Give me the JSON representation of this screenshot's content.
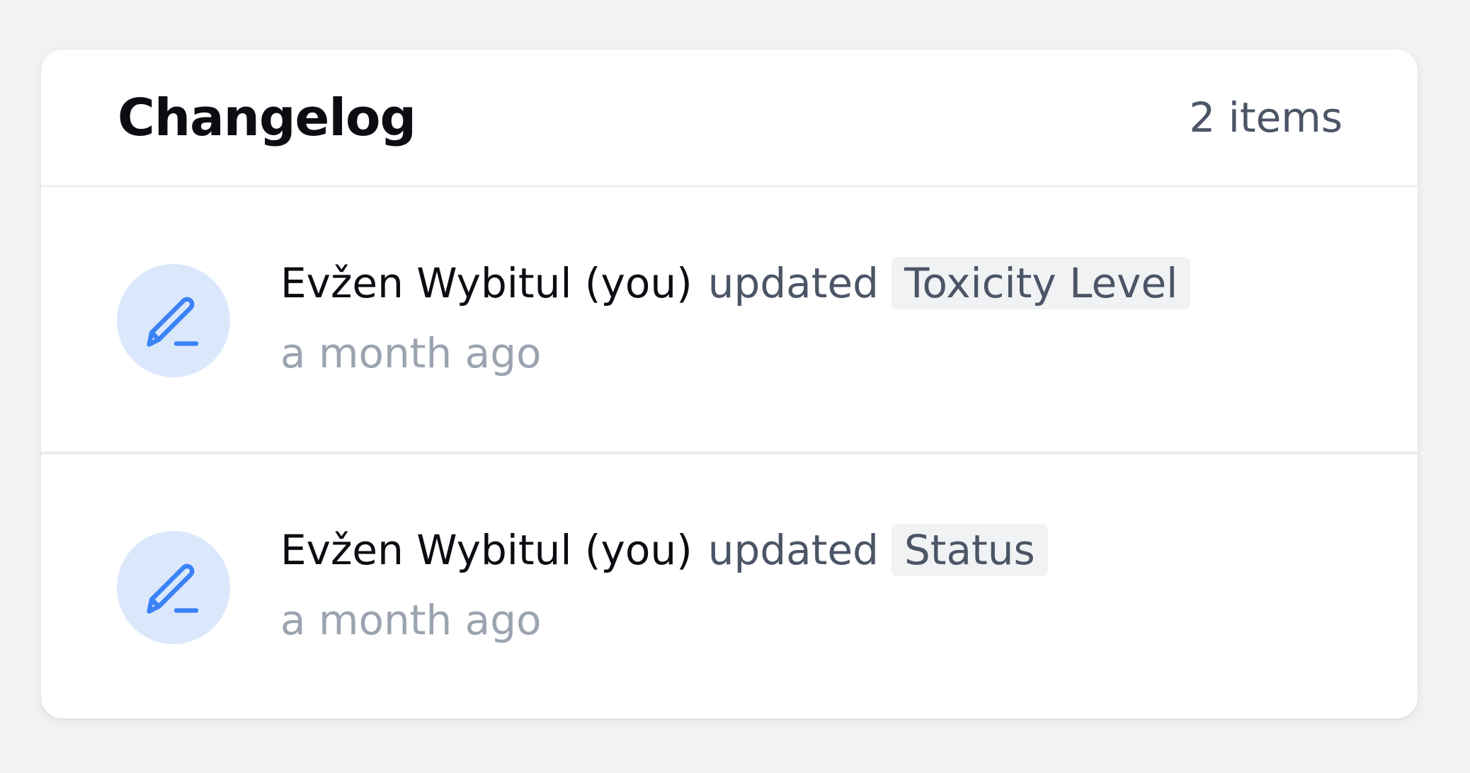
{
  "changelog": {
    "title": "Changelog",
    "count_label": "2 items",
    "entries": [
      {
        "actor": "Evžen Wybitul (you)",
        "action": "updated",
        "field": "Toxicity Level",
        "time": "a month ago",
        "icon": "pencil-icon"
      },
      {
        "actor": "Evžen Wybitul (you)",
        "action": "updated",
        "field": "Status",
        "time": "a month ago",
        "icon": "pencil-icon"
      }
    ]
  },
  "colors": {
    "background": "#f1f2f4",
    "card": "#ffffff",
    "title": "#0b0d12",
    "muted_text": "#4b5566",
    "timestamp": "#9ca3b0",
    "icon_circle": "#dbe8fc",
    "icon_stroke": "#3b82f6",
    "chip_background": "#f1f2f4"
  }
}
